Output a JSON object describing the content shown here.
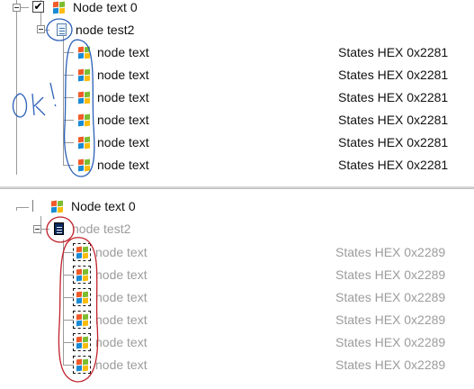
{
  "top_tree": {
    "root": {
      "label": "Node text 0",
      "checked": true
    },
    "child": {
      "label": "node test2"
    },
    "items": [
      {
        "label": "node text",
        "state": "States HEX 0x2281"
      },
      {
        "label": "node text",
        "state": "States HEX 0x2281"
      },
      {
        "label": "node text",
        "state": "States HEX 0x2281"
      },
      {
        "label": "node text",
        "state": "States HEX 0x2281"
      },
      {
        "label": "node text",
        "state": "States HEX 0x2281"
      },
      {
        "label": "node text",
        "state": "States HEX 0x2281"
      }
    ],
    "annotation": {
      "text": "OK!",
      "color": "#2b5fb8"
    }
  },
  "bottom_tree": {
    "root": {
      "label": "Node text 0",
      "checked": false
    },
    "child": {
      "label": "node test2"
    },
    "items": [
      {
        "label": "node text",
        "state": "States HEX 0x2289"
      },
      {
        "label": "node text",
        "state": "States HEX 0x2289"
      },
      {
        "label": "node text",
        "state": "States HEX 0x2289"
      },
      {
        "label": "node text",
        "state": "States HEX 0x2289"
      },
      {
        "label": "node text",
        "state": "States HEX 0x2289"
      },
      {
        "label": "node text",
        "state": "States HEX 0x2289"
      }
    ],
    "annotation": {
      "color": "#c0202a"
    }
  },
  "icons": {
    "root": "windows-logo-icon",
    "child": "document-icon",
    "item": "windows-logo-icon"
  }
}
